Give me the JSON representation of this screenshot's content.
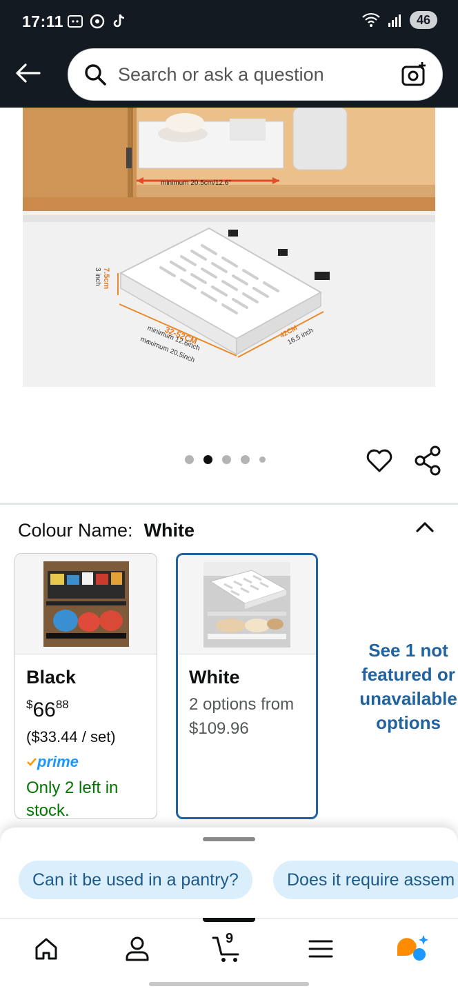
{
  "status_bar": {
    "time": "17:11",
    "battery": "46"
  },
  "search": {
    "placeholder": "Search or ask a question"
  },
  "product_image": {
    "labels": {
      "minimum_width": "minimum 20.5cm/12.6\"",
      "height_cm": "7.5cm",
      "height_in": "3 inch",
      "width_cm": "32-52CM",
      "width_min": "minimum 12.6inch",
      "width_max": "maximum 20.5inch",
      "depth_cm": "42CM",
      "depth_in": "16.5 inch"
    }
  },
  "carousel": {
    "total": 5,
    "active_index": 1
  },
  "colour": {
    "label": "Colour Name:",
    "selected": "White"
  },
  "variants": [
    {
      "name": "Black",
      "price_whole": "66",
      "price_fraction": "88",
      "price_symbol": "$",
      "per_unit": "($33.44 / set)",
      "prime": "prime",
      "stock": "Only 2 left in stock."
    },
    {
      "name": "White",
      "options_text": "2 options from",
      "options_price": "$109.96"
    }
  ],
  "see_more": "See 1 not featured or unavailable options",
  "questions": [
    "Can it be used in a pantry?",
    "Does it require assem"
  ],
  "cart": {
    "count": "9"
  },
  "colors": {
    "header_bg": "#131a22",
    "link": "#2162a1",
    "stock": "#007600",
    "chip_bg": "#dbeefc",
    "assistant_orange": "#ff8c00",
    "assistant_blue": "#1a98ff"
  }
}
